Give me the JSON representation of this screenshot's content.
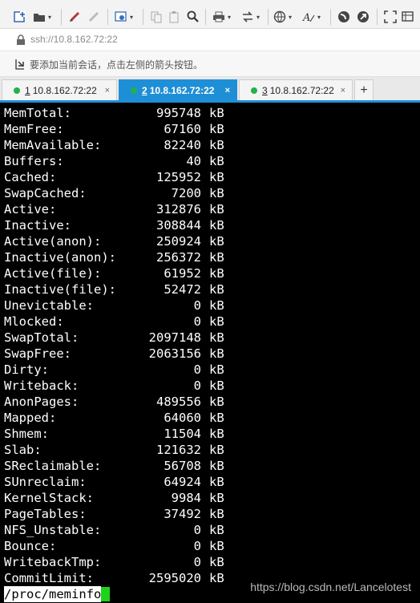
{
  "toolbar": {
    "icons": [
      "new-session-icon",
      "open-folder-icon",
      "draw-icon",
      "stamp-icon",
      "settings-icon",
      "copy-icon",
      "paste-icon",
      "find-icon",
      "print-icon",
      "transfer-icon",
      "globe-icon",
      "font-icon",
      "xshell-icon",
      "xftp-icon",
      "fullscreen-icon",
      "compose-icon"
    ]
  },
  "address": {
    "url": "ssh://10.8.162.72:22"
  },
  "hint": {
    "text": "要添加当前会话，点击左侧的箭头按钮。"
  },
  "tabs": [
    {
      "num": "1",
      "label": "10.8.162.72:22",
      "close": "×",
      "active": false
    },
    {
      "num": "2",
      "label": "10.8.162.72:22",
      "close": "×",
      "active": true
    },
    {
      "num": "3",
      "label": "10.8.162.72:22",
      "close": "×",
      "active": false
    }
  ],
  "add_tab": "+",
  "terminal": {
    "lines": [
      {
        "key": "MemTotal:",
        "value": "995748",
        "unit": "kB"
      },
      {
        "key": "MemFree:",
        "value": "67160",
        "unit": "kB"
      },
      {
        "key": "MemAvailable:",
        "value": "82240",
        "unit": "kB"
      },
      {
        "key": "Buffers:",
        "value": "40",
        "unit": "kB"
      },
      {
        "key": "Cached:",
        "value": "125952",
        "unit": "kB"
      },
      {
        "key": "SwapCached:",
        "value": "7200",
        "unit": "kB"
      },
      {
        "key": "Active:",
        "value": "312876",
        "unit": "kB"
      },
      {
        "key": "Inactive:",
        "value": "308844",
        "unit": "kB"
      },
      {
        "key": "Active(anon):",
        "value": "250924",
        "unit": "kB"
      },
      {
        "key": "Inactive(anon):",
        "value": "256372",
        "unit": "kB"
      },
      {
        "key": "Active(file):",
        "value": "61952",
        "unit": "kB"
      },
      {
        "key": "Inactive(file):",
        "value": "52472",
        "unit": "kB"
      },
      {
        "key": "Unevictable:",
        "value": "0",
        "unit": "kB"
      },
      {
        "key": "Mlocked:",
        "value": "0",
        "unit": "kB"
      },
      {
        "key": "SwapTotal:",
        "value": "2097148",
        "unit": "kB"
      },
      {
        "key": "SwapFree:",
        "value": "2063156",
        "unit": "kB"
      },
      {
        "key": "Dirty:",
        "value": "0",
        "unit": "kB"
      },
      {
        "key": "Writeback:",
        "value": "0",
        "unit": "kB"
      },
      {
        "key": "AnonPages:",
        "value": "489556",
        "unit": "kB"
      },
      {
        "key": "Mapped:",
        "value": "64060",
        "unit": "kB"
      },
      {
        "key": "Shmem:",
        "value": "11504",
        "unit": "kB"
      },
      {
        "key": "Slab:",
        "value": "121632",
        "unit": "kB"
      },
      {
        "key": "SReclaimable:",
        "value": "56708",
        "unit": "kB"
      },
      {
        "key": "SUnreclaim:",
        "value": "64924",
        "unit": "kB"
      },
      {
        "key": "KernelStack:",
        "value": "9984",
        "unit": "kB"
      },
      {
        "key": "PageTables:",
        "value": "37492",
        "unit": "kB"
      },
      {
        "key": "NFS_Unstable:",
        "value": "0",
        "unit": "kB"
      },
      {
        "key": "Bounce:",
        "value": "0",
        "unit": "kB"
      },
      {
        "key": "WritebackTmp:",
        "value": "0",
        "unit": "kB"
      },
      {
        "key": "CommitLimit:",
        "value": "2595020",
        "unit": "kB"
      }
    ],
    "command": "/proc/meminfo",
    "watermark": "https://blog.csdn.net/Lancelotest"
  }
}
